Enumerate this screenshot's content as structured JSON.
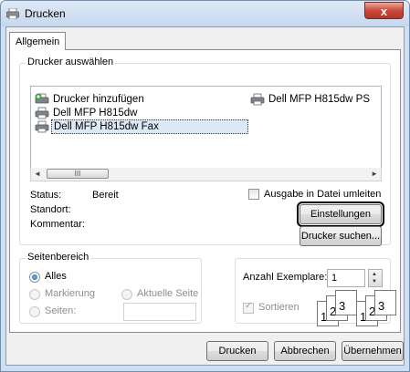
{
  "window": {
    "title": "Drucken",
    "close_glyph": "x"
  },
  "tabs": [
    "Allgemein"
  ],
  "printer_group": {
    "label": "Drucker auswählen",
    "printers": [
      {
        "label": "Drucker hinzufügen",
        "icon": "add-printer-icon"
      },
      {
        "label": "Dell MFP H815dw PS",
        "icon": "printer-icon"
      },
      {
        "label": "Dell MFP H815dw",
        "icon": "printer-icon"
      },
      {
        "label": "Dell MFP H815dw Fax",
        "icon": "printer-icon",
        "selected": true
      }
    ],
    "scroll": {
      "left": "◄",
      "thumb": "III",
      "right": "►"
    },
    "status_label": "Status:",
    "status_value": "Bereit",
    "location_label": "Standort:",
    "comment_label": "Kommentar:",
    "print_to_file": {
      "label": "Ausgabe in Datei umleiten",
      "checked": false
    },
    "settings_button": "Einstellungen",
    "find_printer_button": "Drucker suchen..."
  },
  "range_group": {
    "label": "Seitenbereich",
    "all": "Alles",
    "selection": "Markierung",
    "current_page": "Aktuelle Seite",
    "pages": "Seiten:",
    "selected_option": "Alles"
  },
  "copies": {
    "label": "Anzahl Exemplare:",
    "value": "1",
    "collate_label": "Sortieren",
    "collate_checked": true,
    "collate_pages": [
      "1",
      "2",
      "3"
    ]
  },
  "footer": {
    "print_button": "Drucken",
    "cancel_button": "Abbrechen",
    "apply_button": "Übernehmen"
  },
  "colors": {
    "title_bar": "#c6d8ee",
    "close_button": "#c9483a",
    "selection_radio": "#1e5fae"
  }
}
